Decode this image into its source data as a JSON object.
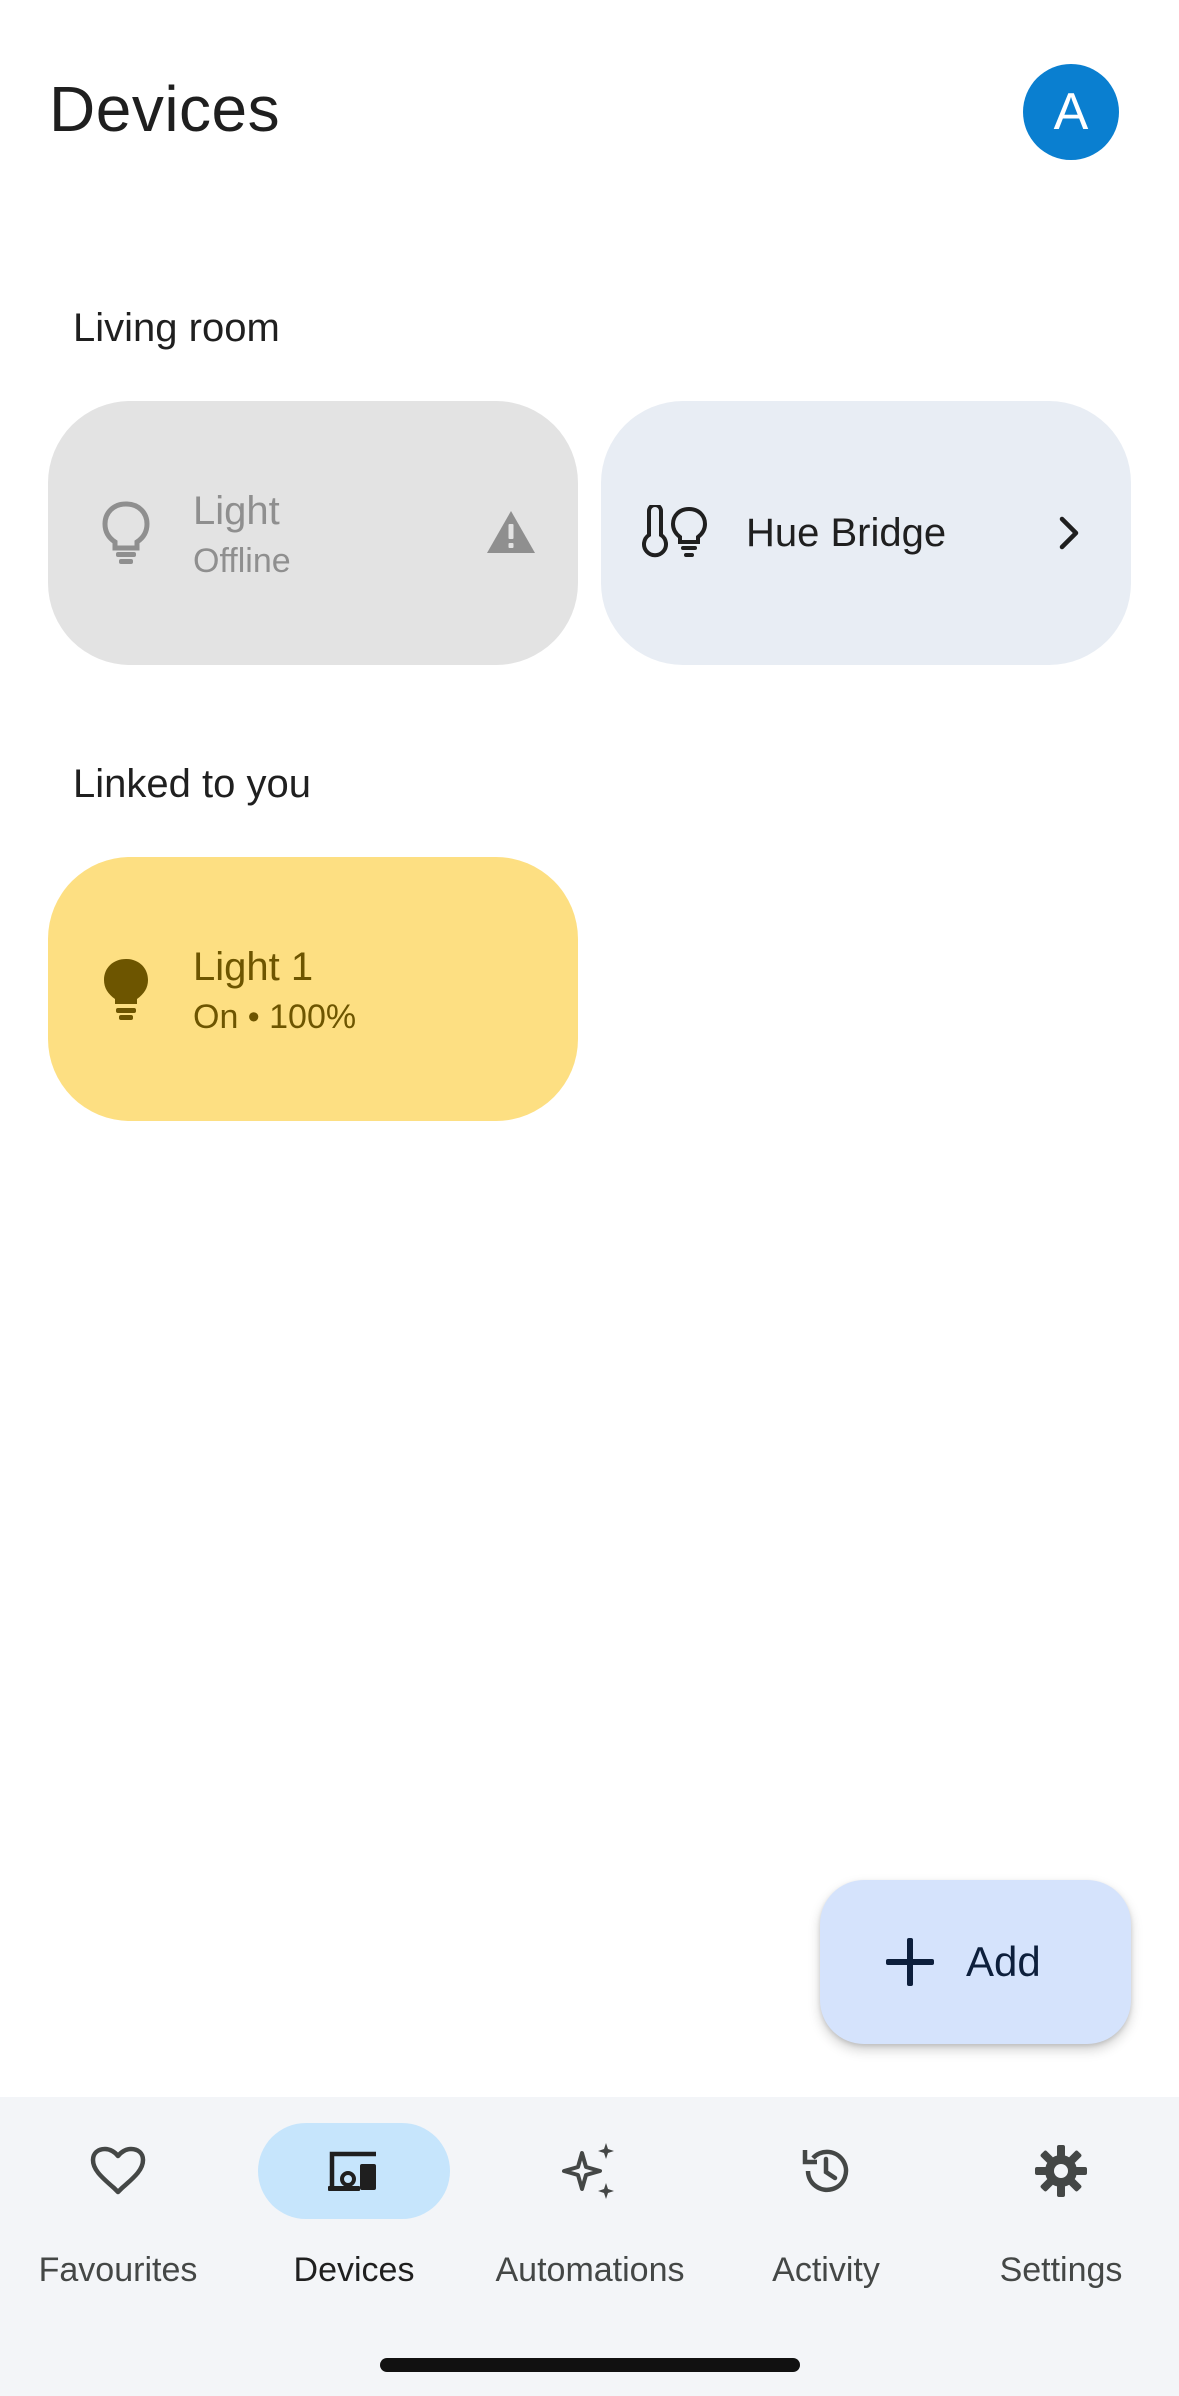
{
  "header": {
    "title": "Devices",
    "avatar_initial": "A"
  },
  "sections": {
    "living_room": {
      "title": "Living room",
      "devices": [
        {
          "name": "Light",
          "status": "Offline",
          "icon": "lightbulb-outline-icon",
          "warning_icon": "warning-icon"
        },
        {
          "name": "Hue Bridge",
          "icon": "thermometer-bulb-icon",
          "chevron_icon": "chevron-right-icon"
        }
      ]
    },
    "linked": {
      "title": "Linked to you",
      "devices": [
        {
          "name": "Light 1",
          "status": "On • 100%",
          "icon": "lightbulb-filled-icon"
        }
      ]
    }
  },
  "fab": {
    "label": "Add",
    "icon": "plus-icon"
  },
  "bottom_nav": {
    "items": [
      {
        "label": "Favourites",
        "icon": "heart-icon",
        "active": false
      },
      {
        "label": "Devices",
        "icon": "devices-icon",
        "active": true
      },
      {
        "label": "Automations",
        "icon": "sparkle-icon",
        "active": false
      },
      {
        "label": "Activity",
        "icon": "history-icon",
        "active": false
      },
      {
        "label": "Settings",
        "icon": "gear-icon",
        "active": false
      }
    ]
  },
  "colors": {
    "avatar": "#0a7fd0",
    "tile_offline": "#e3e3e3",
    "tile_bridge": "#e8edf4",
    "tile_on": "#fddf82",
    "fab": "#d5e3fc",
    "nav_active": "#c6e5fc"
  }
}
